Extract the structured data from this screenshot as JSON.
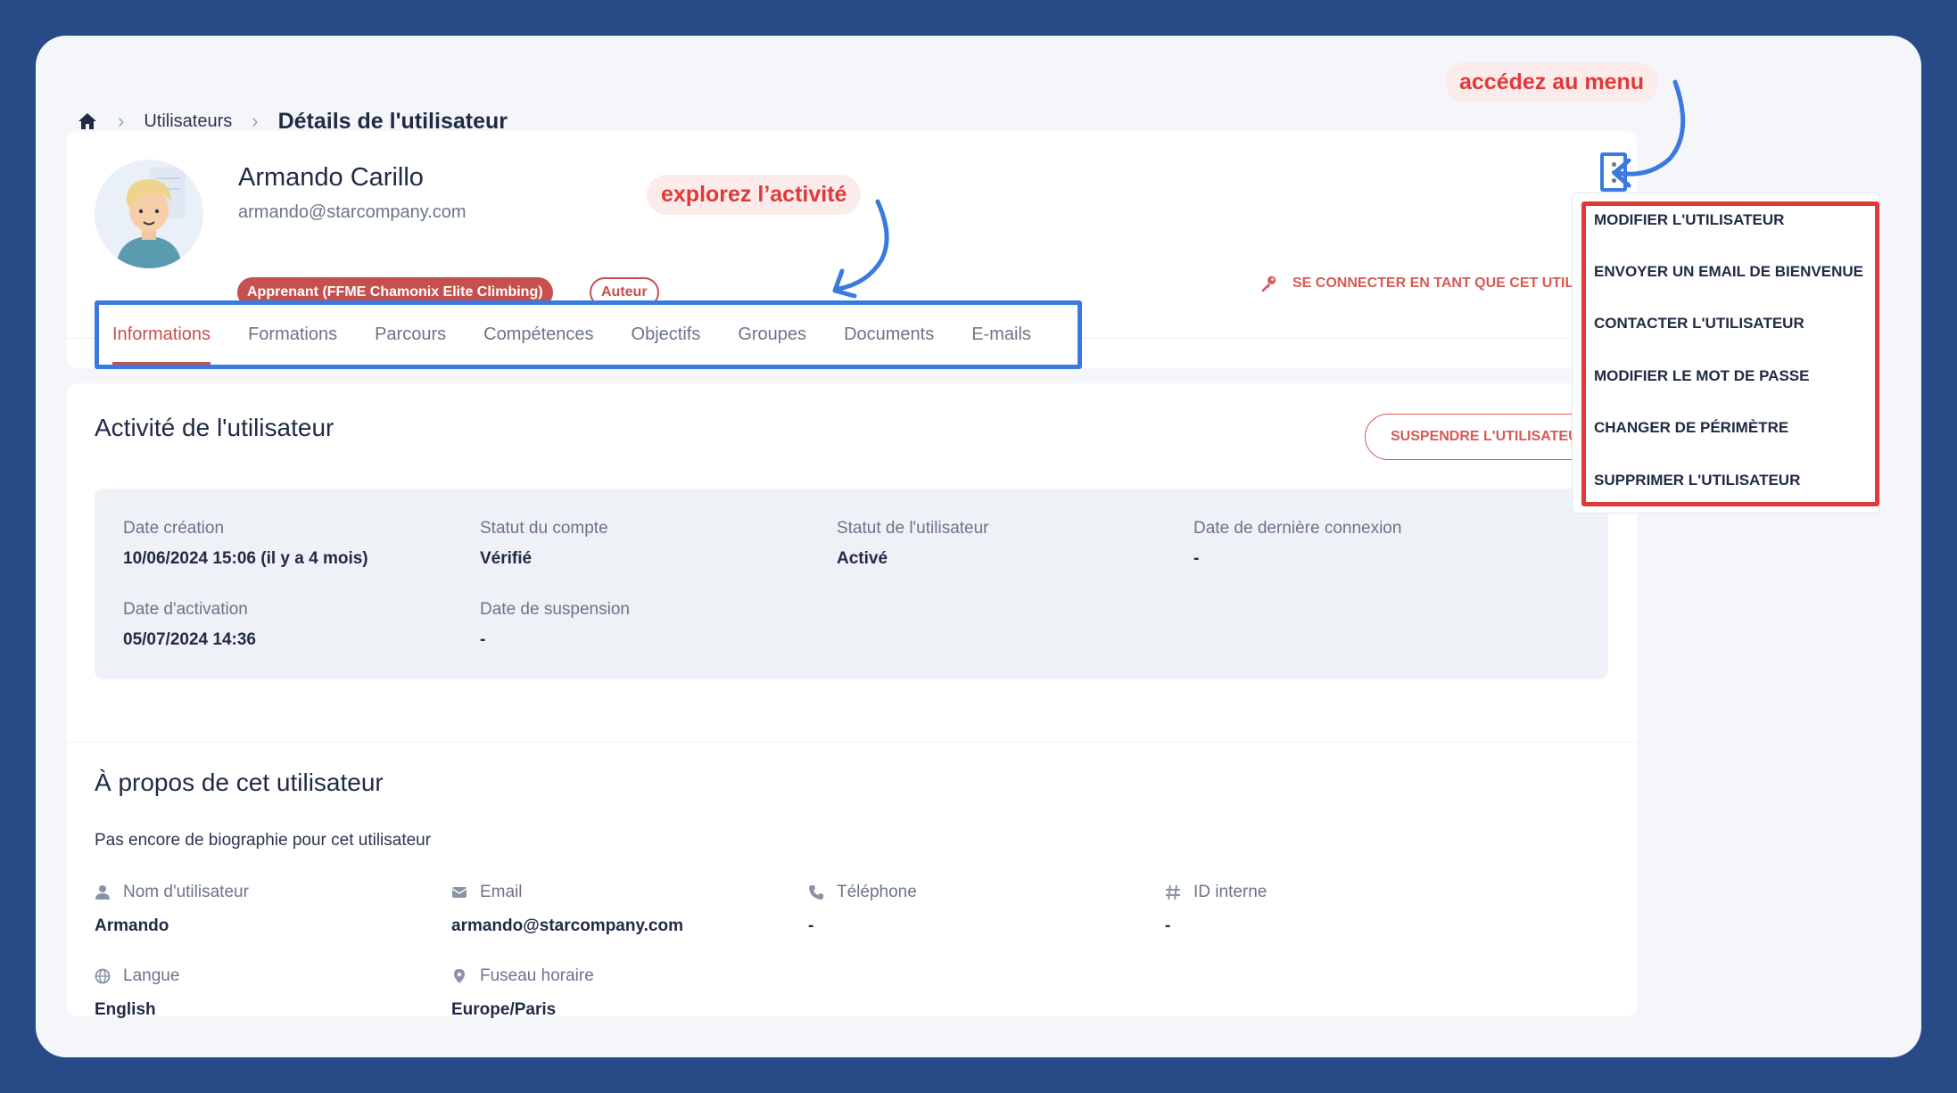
{
  "breadcrumb": {
    "home_icon": "home-icon",
    "link": "Utilisateurs",
    "current": "Détails de l'utilisateur"
  },
  "annotations": {
    "menu": "accédez au menu",
    "activity": "explorez l’activité"
  },
  "profile": {
    "name": "Armando Carillo",
    "email": "armando@starcompany.com",
    "role_badge": "Apprenant (FFME Chamonix Elite Climbing)",
    "author_badge": "Auteur",
    "impersonate": "SE CONNECTER EN TANT QUE CET UTILISATEUR"
  },
  "tabs": [
    {
      "label": "Informations",
      "active": true
    },
    {
      "label": "Formations"
    },
    {
      "label": "Parcours"
    },
    {
      "label": "Compétences"
    },
    {
      "label": "Objectifs"
    },
    {
      "label": "Groupes"
    },
    {
      "label": "Documents"
    },
    {
      "label": "E-mails"
    }
  ],
  "activity": {
    "title": "Activité de l'utilisateur",
    "suspend_button": "SUSPENDRE L'UTILISATEUR",
    "fields": [
      {
        "label": "Date création",
        "value": "10/06/2024 15:06 (il y a 4 mois)"
      },
      {
        "label": "Statut du compte",
        "value": "Vérifié"
      },
      {
        "label": "Statut de l'utilisateur",
        "value": "Activé"
      },
      {
        "label": "Date de dernière connexion",
        "value": "-"
      },
      {
        "label": "Date d'activation",
        "value": "05/07/2024 14:36"
      },
      {
        "label": "Date de suspension",
        "value": "-"
      }
    ]
  },
  "about": {
    "title": "À propos de cet utilisateur",
    "bio": "Pas encore de biographie pour cet utilisateur",
    "fields": [
      {
        "icon": "user-icon",
        "label": "Nom d'utilisateur",
        "value": "Armando"
      },
      {
        "icon": "envelope-icon",
        "label": "Email",
        "value": "armando@starcompany.com"
      },
      {
        "icon": "phone-icon",
        "label": "Téléphone",
        "value": "-"
      },
      {
        "icon": "hash-icon",
        "label": "ID interne",
        "value": "-"
      },
      {
        "icon": "globe-icon",
        "label": "Langue",
        "value": "English"
      },
      {
        "icon": "map-pin-icon",
        "label": "Fuseau horaire",
        "value": "Europe/Paris"
      }
    ]
  },
  "menu": {
    "items": [
      "MODIFIER L'UTILISATEUR",
      "ENVOYER UN EMAIL DE BIENVENUE",
      "CONTACTER L'UTILISATEUR",
      "MODIFIER LE MOT DE PASSE",
      "CHANGER DE PÉRIMÈTRE",
      "SUPPRIMER L'UTILISATEUR"
    ]
  },
  "colors": {
    "background": "#284b87",
    "accent": "#c6504d",
    "highlight_blue": "#3a7ae0",
    "highlight_red": "#e0393a"
  }
}
